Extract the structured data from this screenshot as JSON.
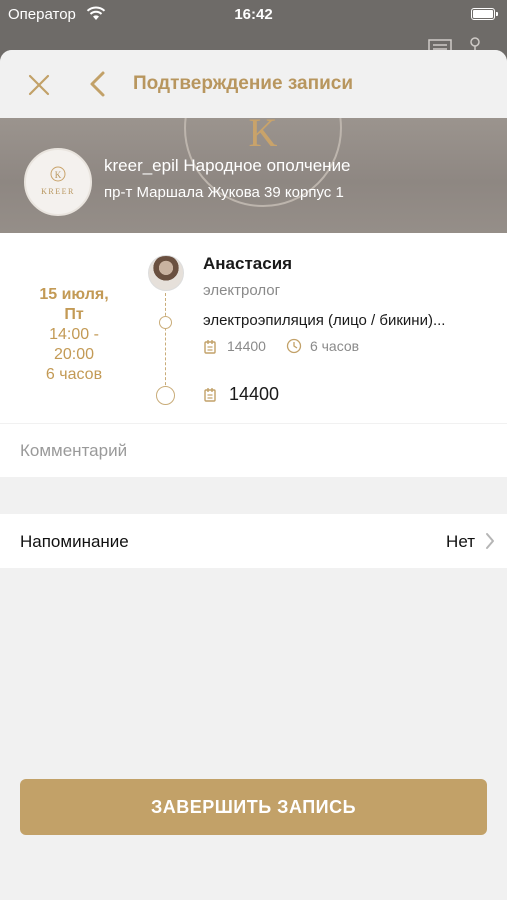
{
  "status_bar": {
    "carrier": "Оператор",
    "time": "16:42"
  },
  "nav": {
    "title": "Подтверждение записи"
  },
  "salon": {
    "logo_letter": "K",
    "logo_text": "KREER",
    "name": "kreer_epil Народное ополчение",
    "address": "пр-т Маршала Жукова 39 корпус 1"
  },
  "booking": {
    "date": "15 июля,",
    "weekday": "Пт",
    "time_range_start": "14:00 -",
    "time_range_end": "20:00",
    "duration_total": "6 часов",
    "master_name": "Анастасия",
    "master_role": "электролог",
    "service_name": "электроэпиляция (лицо / бикини)...",
    "service_price": "14400",
    "service_duration": "6 часов",
    "total_price": "14400"
  },
  "comment": {
    "placeholder": "Комментарий"
  },
  "reminder": {
    "label": "Напоминание",
    "value": "Нет"
  },
  "submit": {
    "label": "ЗАВЕРШИТЬ ЗАПИСЬ"
  },
  "colors": {
    "accent": "#c2a168",
    "accent_text": "#b8965e",
    "background": "#f1f1f1"
  }
}
